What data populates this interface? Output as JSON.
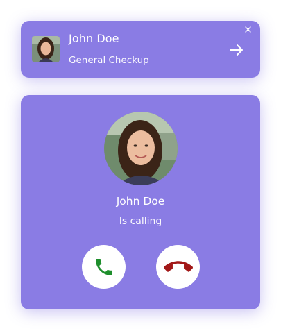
{
  "notification": {
    "caller_name": "John Doe",
    "subtitle": "General Checkup",
    "close_icon": "close-icon",
    "open_icon": "arrow-right-icon"
  },
  "call": {
    "caller_name": "John Doe",
    "status": "Is calling",
    "accept_icon": "phone-accept-icon",
    "decline_icon": "phone-decline-icon",
    "accept_color": "#1e8e2c",
    "decline_color": "#a21818"
  },
  "theme": {
    "card_background": "#8a7ce4",
    "text_color": "#ffffff"
  }
}
